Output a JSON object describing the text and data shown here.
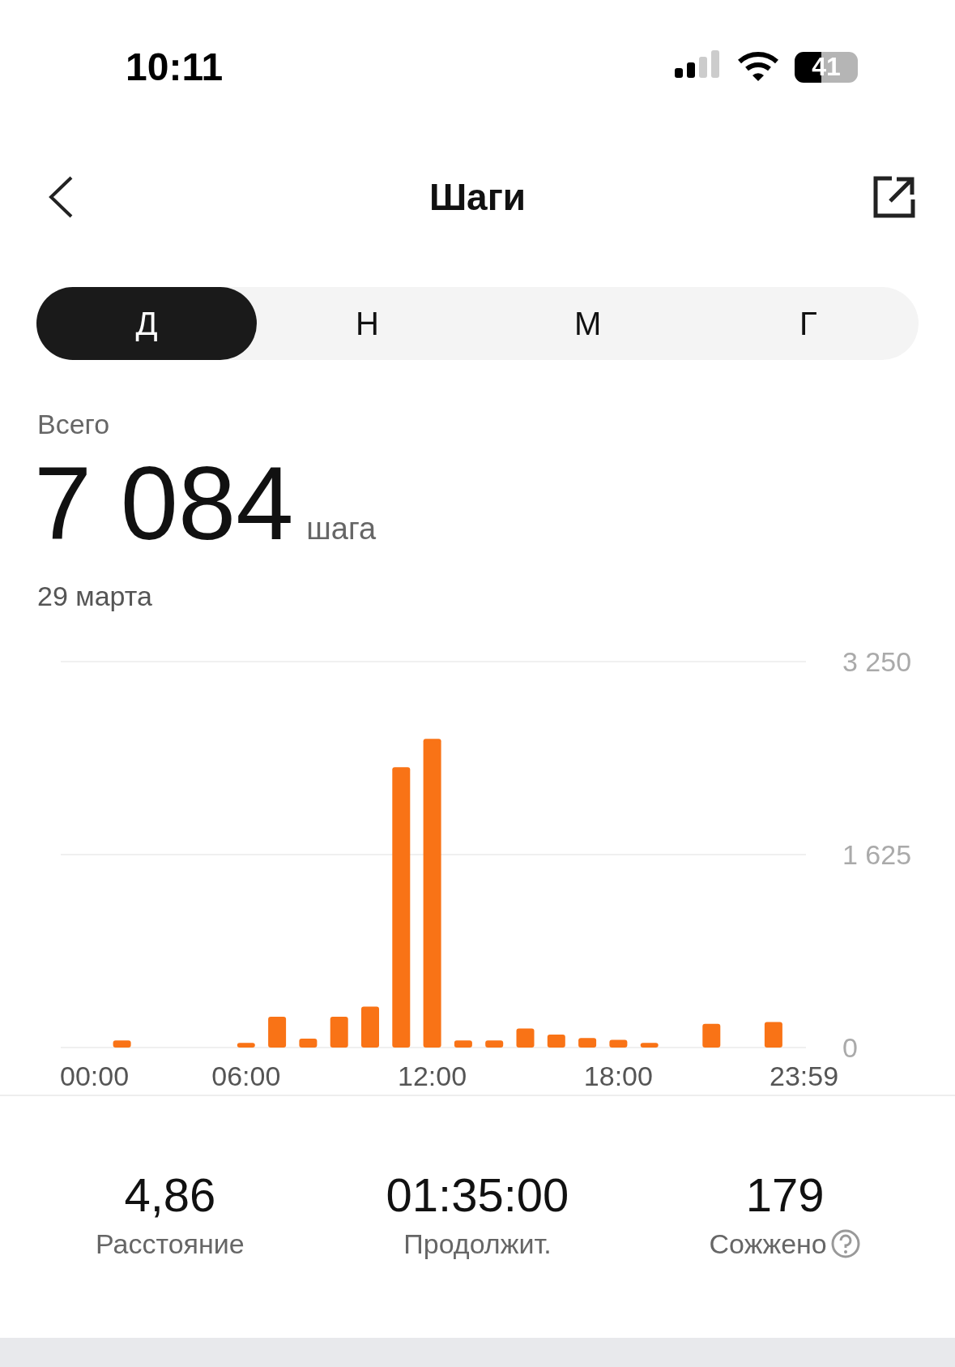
{
  "status_bar": {
    "time": "10:11",
    "battery": "41"
  },
  "header": {
    "title": "Шаги"
  },
  "tabs": [
    {
      "label": "Д",
      "selected": true
    },
    {
      "label": "Н",
      "selected": false
    },
    {
      "label": "М",
      "selected": false
    },
    {
      "label": "Г",
      "selected": false
    }
  ],
  "summary": {
    "label": "Всего",
    "value": "7 084",
    "unit": "шага",
    "date": "29 марта"
  },
  "chart_data": {
    "type": "bar",
    "x": [
      2,
      6,
      7,
      8,
      9,
      10,
      11,
      12,
      13,
      14,
      15,
      16,
      17,
      18,
      19,
      21,
      23
    ],
    "series": [
      {
        "color": "#f97316",
        "values": [
          60,
          40,
          260,
          75,
          260,
          345,
          2360,
          2600,
          60,
          60,
          160,
          110,
          80,
          65,
          40,
          200,
          215
        ]
      }
    ],
    "ylim": [
      0,
      3250
    ],
    "yticks": [
      {
        "value": 0,
        "label": "0"
      },
      {
        "value": 1625,
        "label": "1 625"
      },
      {
        "value": 3250,
        "label": "3 250"
      }
    ],
    "xlim": [
      0,
      24
    ],
    "xticks": [
      {
        "value": 0,
        "label": "00:00"
      },
      {
        "value": 6,
        "label": "06:00"
      },
      {
        "value": 12,
        "label": "12:00"
      },
      {
        "value": 18,
        "label": "18:00"
      },
      {
        "value": 23.983,
        "label": "23:59"
      }
    ]
  },
  "stats": [
    {
      "value": "4,86",
      "label": "Расстояние",
      "help": false
    },
    {
      "value": "01:35:00",
      "label": "Продолжит.",
      "help": false
    },
    {
      "value": "179",
      "label": "Сожжено",
      "help": true
    }
  ]
}
